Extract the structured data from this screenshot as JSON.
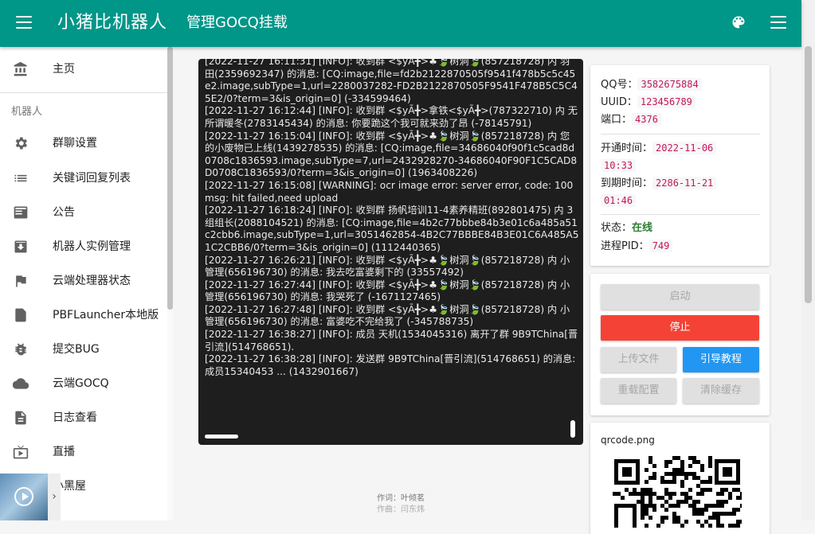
{
  "appbar": {
    "app_title": "小猪比机器人",
    "page_title": "管理GOCQ挂载"
  },
  "sidebar": {
    "home_label": "主页",
    "section_label": "机器人",
    "items": [
      {
        "label": "群聊设置",
        "icon": "gear-icon"
      },
      {
        "label": "关键词回复列表",
        "icon": "list-icon"
      },
      {
        "label": "公告",
        "icon": "announcement-icon"
      },
      {
        "label": "机器人实例管理",
        "icon": "archive-icon"
      },
      {
        "label": "云端处理器状态",
        "icon": "flag-icon"
      },
      {
        "label": "PBFLauncher本地版",
        "icon": "launcher-icon"
      },
      {
        "label": "提交BUG",
        "icon": "bug-icon"
      },
      {
        "label": "云端GOCQ",
        "icon": "cloud-icon"
      },
      {
        "label": "日志查看",
        "icon": "document-icon"
      },
      {
        "label": "直播",
        "icon": "tv-icon"
      },
      {
        "label": "小黑屋",
        "icon": "blacklist-icon"
      }
    ]
  },
  "terminal": {
    "log": "[2022-11-27 16:11:31] [INFO]: 收到群 <$yÃ╋>♣🍃树洞🍃(857218728) 内 羽田(2359692347) 的消息: [CQ:image,file=fd2b2122870505f9541f478b5c5c45e2.image,subType=1,url=2280037282-FD2B2122870505F9541F478B5C5C45E2/0?term=3&is_origin=0] (-334599464)\n[2022-11-27 16:12:44] [INFO]: 收到群 <$yÃ╋>拿铁<$yÃ╋>(787322710) 内 无所谓暖冬(2783145434) 的消息: 你要跪这个我可就来劲了昂 (-78145791)\n[2022-11-27 16:15:04] [INFO]: 收到群 <$yÃ╋>♣🍃树洞🍃(857218728) 内 您的小废物已上线(1439278535) 的消息: [CQ:image,file=34686040f90f1c5cad8d0708c1836593.image,subType=7,url=2432928270-34686040F90F1C5CAD8D0708C1836593/0?term=3&is_origin=0] (1963408226)\n[2022-11-27 16:15:08] [WARNING]: ocr image error: server error, code: 100 msg: hit failed,need upload\n[2022-11-27 16:18:24] [INFO]: 收到群 扬帆培训11-4素养精班(892801475) 内 3组组长(2088104521) 的消息: [CQ:image,file=4b2c77bbbe84b3e01c6a485a51c2cbb6.image,subType=1,url=3051462854-4B2C77BBBE84B3E01C6A485A51C2CBB6/0?term=3&is_origin=0] (1112440365)\n[2022-11-27 16:26:21] [INFO]: 收到群 <$yÃ╋>♣🍃树洞🍃(857218728) 内 小管理(656196730) 的消息: 我去吃富婆剩下的 (33557492)\n[2022-11-27 16:27:44] [INFO]: 收到群 <$yÃ╋>♣🍃树洞🍃(857218728) 内 小管理(656196730) 的消息: 我哭死了 (-1671127465)\n[2022-11-27 16:27:48] [INFO]: 收到群 <$yÃ╋>♣🍃树洞🍃(857218728) 内 小管理(656196730) 的消息: 富婆吃不完给我了 (-345788735)\n[2022-11-27 16:38:27] [INFO]: 成员 天机(1534045316) 离开了群 9B9TChina[晋引流](514768651).\n[2022-11-27 16:38:28] [INFO]: 发送群 9B9TChina[晋引流](514768651) 的消息: 成员15340453 ... (1432901667)"
  },
  "info": {
    "qq_label": "QQ号：",
    "qq_value": "3582675884",
    "uuid_label": "UUID：",
    "uuid_value": "123456789",
    "port_label": "端口：",
    "port_value": "4376",
    "open_label": "开通时间：",
    "open_date": "2022-11-06",
    "open_time": "10:33",
    "expire_label": "到期时间：",
    "expire_date": "2286-11-21",
    "expire_time": "01:46",
    "status_label": "状态：",
    "status_value": "在线",
    "pid_label": "进程PID：",
    "pid_value": "749"
  },
  "actions": {
    "start": "启动",
    "stop": "停止",
    "upload": "上传文件",
    "guide": "引导教程",
    "reload": "重载配置",
    "clear_cache": "清除缓存"
  },
  "qr": {
    "filename": "qrcode.png"
  },
  "credits": {
    "lyricist": "作词：叶倾茗",
    "composer": "作曲：闫东炜"
  },
  "colors": {
    "primary": "#009688",
    "danger": "#f44336",
    "accent": "#2196f3",
    "online": "#2e7d32"
  }
}
